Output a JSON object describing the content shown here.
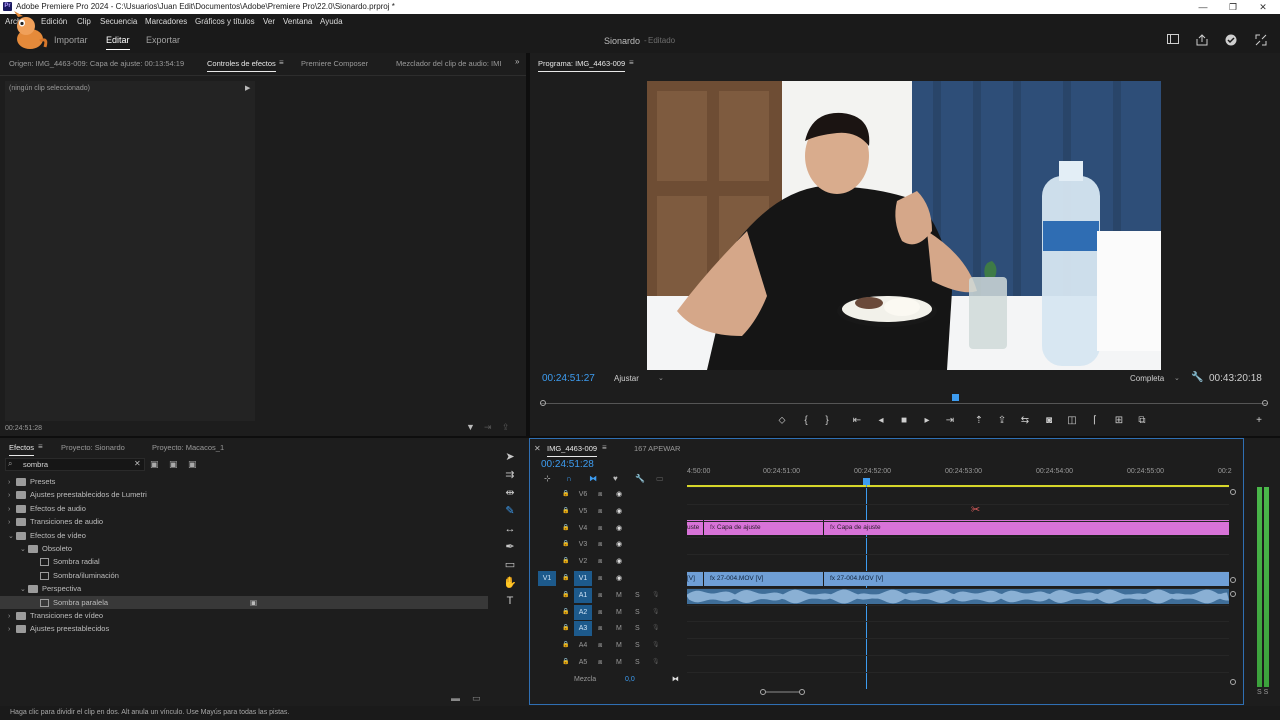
{
  "window": {
    "title": "Adobe Premiere Pro 2024 - C:\\Usuarios\\Juan Edit\\Documentos\\Adobe\\Premiere Pro\\22.0\\Sionardo.prproj *",
    "icon_text": "Pr",
    "minimize": "—",
    "maximize": "❐",
    "close": "✕"
  },
  "menu": [
    "Archivo",
    "Edición",
    "Clip",
    "Secuencia",
    "Marcadores",
    "Gráficos y títulos",
    "Ver",
    "Ventana",
    "Ayuda"
  ],
  "header": {
    "workspaces": [
      "Importar",
      "Editar",
      "Exportar"
    ],
    "active_workspace": "Editar",
    "project_name": "Sionardo",
    "project_status": "Editado"
  },
  "source_panel": {
    "tabs": [
      "Origen: IMG_4463-009: Capa de ajuste: 00:13:54:19",
      "Controles de efectos",
      "Premiere Composer",
      "Mezclador del clip de audio: IMI"
    ],
    "active_tab": "Controles de efectos",
    "empty_message": "(ningún clip seleccionado)",
    "timecode": "00:24:51:28"
  },
  "program_panel": {
    "title": "Programa: IMG_4463-009",
    "timecode_current": "00:24:51:27",
    "fit": "Ajustar",
    "resolution": "Completa",
    "timecode_duration": "00:43:20:18"
  },
  "effects_panel": {
    "tabs": [
      "Efectos",
      "Proyecto: Sionardo",
      "Proyecto: Macacos_1"
    ],
    "active_tab": "Efectos",
    "search_value": "sombra",
    "tree": [
      {
        "label": "Presets",
        "level": 0,
        "type": "folder",
        "expanded": false
      },
      {
        "label": "Ajustes preestablecidos de Lumetri",
        "level": 0,
        "type": "folder",
        "expanded": false
      },
      {
        "label": "Efectos de audio",
        "level": 0,
        "type": "folder",
        "expanded": false
      },
      {
        "label": "Transiciones de audio",
        "level": 0,
        "type": "folder",
        "expanded": false
      },
      {
        "label": "Efectos de vídeo",
        "level": 0,
        "type": "folder",
        "expanded": true
      },
      {
        "label": "Obsoleto",
        "level": 1,
        "type": "folder",
        "expanded": true
      },
      {
        "label": "Sombra radial",
        "level": 2,
        "type": "effect"
      },
      {
        "label": "Sombra/iluminación",
        "level": 2,
        "type": "effect"
      },
      {
        "label": "Perspectiva",
        "level": 1,
        "type": "folder",
        "expanded": true
      },
      {
        "label": "Sombra paralela",
        "level": 2,
        "type": "effect",
        "selected": true
      },
      {
        "label": "Transiciones de vídeo",
        "level": 0,
        "type": "folder",
        "expanded": false
      },
      {
        "label": "Ajustes preestablecidos",
        "level": 0,
        "type": "folder",
        "expanded": false
      }
    ]
  },
  "timeline": {
    "tabs": [
      "IMG_4463-009",
      "167 APEWAR"
    ],
    "active_tab": "IMG_4463-009",
    "timecode": "00:24:51:28",
    "ruler": [
      "4:50:00",
      "00:24:51:00",
      "00:24:52:00",
      "00:24:53:00",
      "00:24:54:00",
      "00:24:55:00",
      "00:2"
    ],
    "video_tracks": [
      "V6",
      "V5",
      "V4",
      "V3",
      "V2",
      "V1"
    ],
    "audio_tracks": [
      "A1",
      "A2",
      "A3",
      "A4",
      "A5"
    ],
    "source_patch_v": "V1",
    "mix_label": "Mezcla",
    "mix_value": "0,0",
    "adjust_clips": [
      "uste",
      "Capa de ajuste",
      "Capa de ajuste"
    ],
    "video_clips": [
      "[V]",
      "27-004.MOV [V]",
      "27-004.MOV [V]"
    ],
    "track_buttons": {
      "mute": "M",
      "solo": "S"
    }
  },
  "status_bar": "Haga clic para dividir el clip en dos. Alt anula un vínculo. Use Mayús para todas las pistas.",
  "meter_labels": "S S",
  "colors": {
    "accent": "#3d9cf0",
    "adjustment_clip": "#d873d8",
    "video_clip": "#6f9fd6",
    "audio_clip": "#4f7fae",
    "playhead": "#3d9cf0"
  }
}
